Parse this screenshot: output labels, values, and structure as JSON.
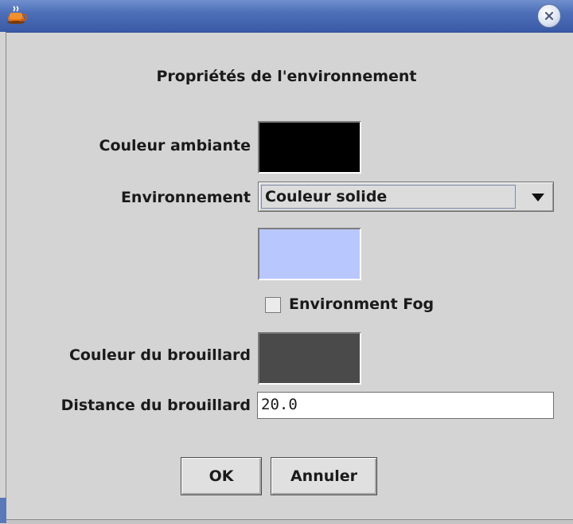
{
  "window": {
    "title": "",
    "close_icon": "close-icon",
    "app_icon": "java-cup-icon"
  },
  "dialog": {
    "heading": "Propriétés de l'environnement"
  },
  "fields": {
    "ambient_label": "Couleur ambiante",
    "ambient_color": "#000000",
    "environment_label": "Environnement",
    "environment_value": "Couleur solide",
    "environment_color": "#b9c7ff",
    "fog_checkbox_label": "Environment Fog",
    "fog_checked": false,
    "fog_color_label": "Couleur du brouillard",
    "fog_color": "#4a4a4a",
    "fog_distance_label": "Distance du brouillard",
    "fog_distance_value": "20.0"
  },
  "buttons": {
    "ok": "OK",
    "cancel": "Annuler"
  }
}
